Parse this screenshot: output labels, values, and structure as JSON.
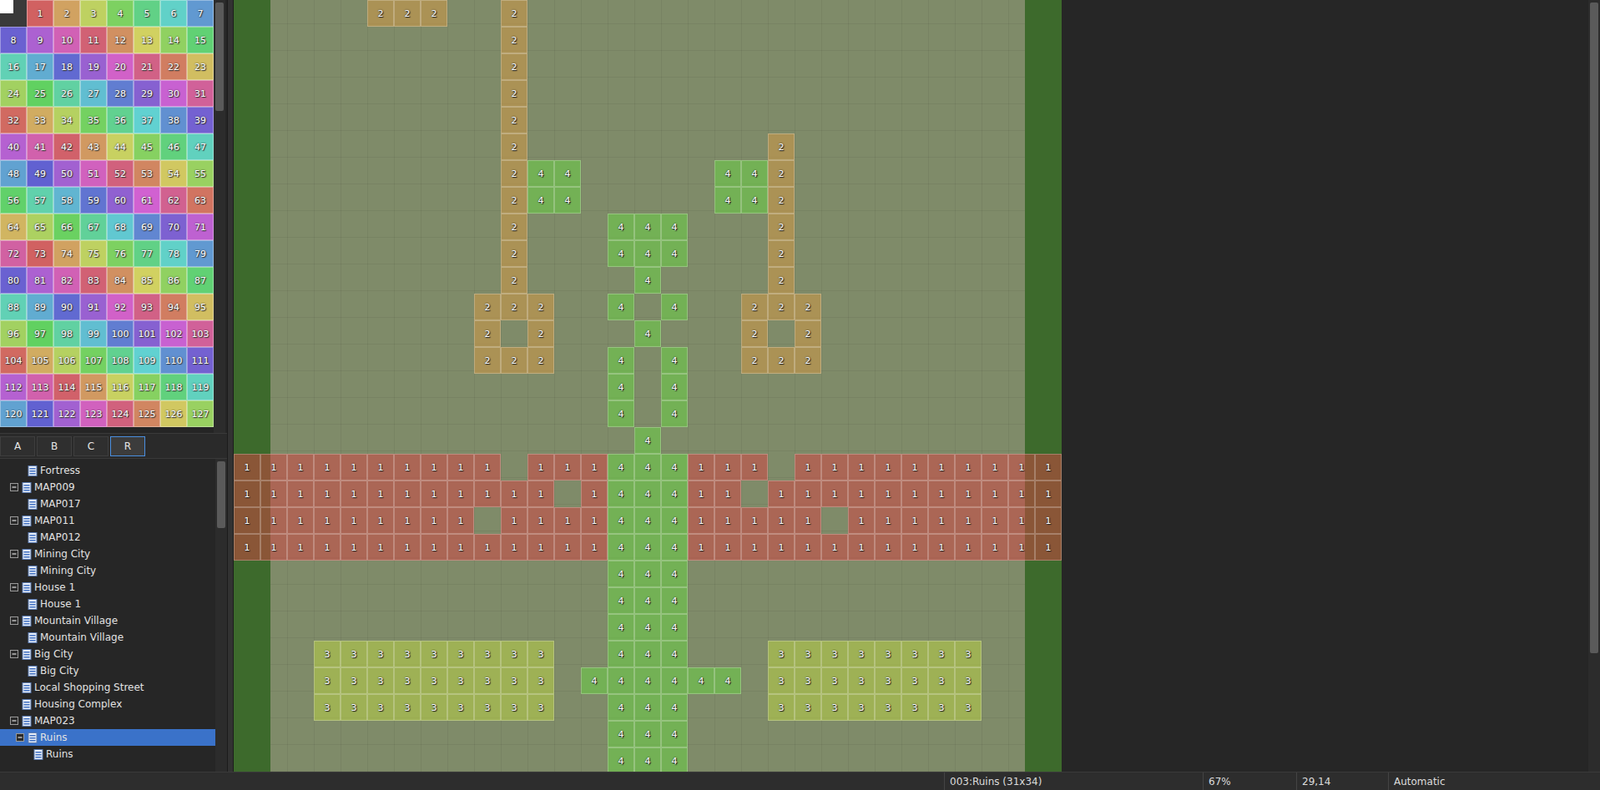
{
  "palette": {
    "eraser": true,
    "regions": [
      "1",
      "2",
      "3",
      "4",
      "5",
      "6",
      "7",
      "8",
      "9",
      "10",
      "11",
      "12",
      "13",
      "14",
      "15",
      "16",
      "17",
      "18",
      "19",
      "20",
      "21",
      "22",
      "23",
      "24",
      "25",
      "26",
      "27",
      "28",
      "29",
      "30",
      "31",
      "32",
      "33",
      "34",
      "35",
      "36",
      "37",
      "38",
      "39",
      "40",
      "41",
      "42",
      "43",
      "44",
      "45",
      "46",
      "47",
      "48",
      "49",
      "50",
      "51",
      "52",
      "53",
      "54",
      "55",
      "56",
      "57",
      "58",
      "59",
      "60",
      "61",
      "62",
      "63",
      "64",
      "65",
      "66",
      "67",
      "68",
      "69",
      "70",
      "71",
      "72",
      "73",
      "74",
      "75",
      "76",
      "77",
      "78",
      "79",
      "80",
      "81",
      "82",
      "83",
      "84",
      "85",
      "86",
      "87",
      "88",
      "89",
      "90",
      "91",
      "92",
      "93",
      "94",
      "95",
      "96",
      "97",
      "98",
      "99",
      "100",
      "101",
      "102",
      "103",
      "104",
      "105",
      "106",
      "107",
      "108",
      "109",
      "110",
      "111",
      "112",
      "113",
      "114",
      "115",
      "116",
      "117",
      "118",
      "119",
      "120",
      "121",
      "122",
      "123",
      "124",
      "125",
      "126",
      "127"
    ]
  },
  "tabs": [
    {
      "label": "A",
      "selected": false
    },
    {
      "label": "B",
      "selected": false
    },
    {
      "label": "C",
      "selected": false
    },
    {
      "label": "R",
      "selected": true
    }
  ],
  "tree": [
    {
      "label": "Fortress",
      "level": 2,
      "kind": "leaf",
      "expanded": false,
      "selected": false
    },
    {
      "label": "MAP009",
      "level": 1,
      "kind": "parent",
      "expanded": true,
      "selected": false
    },
    {
      "label": "MAP017",
      "level": 2,
      "kind": "leaf",
      "expanded": false,
      "selected": false
    },
    {
      "label": "MAP011",
      "level": 1,
      "kind": "parent",
      "expanded": true,
      "selected": false
    },
    {
      "label": "MAP012",
      "level": 2,
      "kind": "leaf",
      "expanded": false,
      "selected": false
    },
    {
      "label": "Mining City",
      "level": 1,
      "kind": "parent",
      "expanded": true,
      "selected": false
    },
    {
      "label": "Mining City",
      "level": 2,
      "kind": "leaf",
      "expanded": false,
      "selected": false
    },
    {
      "label": "House 1",
      "level": 1,
      "kind": "parent",
      "expanded": true,
      "selected": false
    },
    {
      "label": "House 1",
      "level": 2,
      "kind": "leaf",
      "expanded": false,
      "selected": false
    },
    {
      "label": "Mountain Village",
      "level": 1,
      "kind": "parent",
      "expanded": true,
      "selected": false
    },
    {
      "label": "Mountain Village",
      "level": 2,
      "kind": "leaf",
      "expanded": false,
      "selected": false
    },
    {
      "label": "Big City",
      "level": 1,
      "kind": "parent",
      "expanded": true,
      "selected": false
    },
    {
      "label": "Big City",
      "level": 2,
      "kind": "leaf",
      "expanded": false,
      "selected": false
    },
    {
      "label": "Local Shopping Street",
      "level": 1,
      "kind": "leaf",
      "expanded": false,
      "selected": false
    },
    {
      "label": "Housing Complex",
      "level": 1,
      "kind": "leaf",
      "expanded": false,
      "selected": false
    },
    {
      "label": "MAP023",
      "level": 1,
      "kind": "parent",
      "expanded": true,
      "selected": false
    },
    {
      "label": "Ruins",
      "level": 2,
      "kind": "parent",
      "expanded": true,
      "selected": true
    },
    {
      "label": "Ruins",
      "level": 3,
      "kind": "leaf",
      "expanded": false,
      "selected": false
    }
  ],
  "map": {
    "rows": [
      [
        "",
        "",
        "",
        "",
        "",
        "2",
        "2",
        "2",
        "",
        "",
        "2",
        "",
        "",
        "",
        "",
        "",
        "",
        "",
        "",
        "",
        "",
        "",
        "",
        "",
        "",
        "",
        "",
        "",
        "",
        "",
        ""
      ],
      [
        "",
        "",
        "",
        "",
        "",
        "",
        "",
        "",
        "",
        "",
        "2",
        "",
        "",
        "",
        "",
        "",
        "",
        "",
        "",
        "",
        "",
        "",
        "",
        "",
        "",
        "",
        "",
        "",
        "",
        "",
        ""
      ],
      [
        "",
        "",
        "",
        "",
        "",
        "",
        "",
        "",
        "",
        "",
        "2",
        "",
        "",
        "",
        "",
        "",
        "",
        "",
        "",
        "",
        "",
        "",
        "",
        "",
        "",
        "",
        "",
        "",
        "",
        "",
        ""
      ],
      [
        "",
        "",
        "",
        "",
        "",
        "",
        "",
        "",
        "",
        "",
        "2",
        "",
        "",
        "",
        "",
        "",
        "",
        "",
        "",
        "",
        "",
        "",
        "",
        "",
        "",
        "",
        "",
        "",
        "",
        "",
        ""
      ],
      [
        "",
        "",
        "",
        "",
        "",
        "",
        "",
        "",
        "",
        "",
        "2",
        "",
        "",
        "",
        "",
        "",
        "",
        "",
        "",
        "",
        "",
        "",
        "",
        "",
        "",
        "",
        "",
        "",
        "",
        "",
        ""
      ],
      [
        "",
        "",
        "",
        "",
        "",
        "",
        "",
        "",
        "",
        "",
        "2",
        "",
        "",
        "",
        "",
        "",
        "",
        "",
        "",
        "",
        "2",
        "",
        "",
        "",
        "",
        "",
        "",
        "",
        "",
        "",
        ""
      ],
      [
        "",
        "",
        "",
        "",
        "",
        "",
        "",
        "",
        "",
        "",
        "2",
        "4",
        "4",
        "",
        "",
        "",
        "",
        "",
        "4",
        "4",
        "2",
        "",
        "",
        "",
        "",
        "",
        "",
        "",
        "",
        "",
        ""
      ],
      [
        "",
        "",
        "",
        "",
        "",
        "",
        "",
        "",
        "",
        "",
        "2",
        "4",
        "4",
        "",
        "",
        "",
        "",
        "",
        "4",
        "4",
        "2",
        "",
        "",
        "",
        "",
        "",
        "",
        "",
        "",
        "",
        ""
      ],
      [
        "",
        "",
        "",
        "",
        "",
        "",
        "",
        "",
        "",
        "",
        "2",
        "",
        "",
        "",
        "4",
        "4",
        "4",
        "",
        "",
        "",
        "2",
        "",
        "",
        "",
        "",
        "",
        "",
        "",
        "",
        "",
        ""
      ],
      [
        "",
        "",
        "",
        "",
        "",
        "",
        "",
        "",
        "",
        "",
        "2",
        "",
        "",
        "",
        "4",
        "4",
        "4",
        "",
        "",
        "",
        "2",
        "",
        "",
        "",
        "",
        "",
        "",
        "",
        "",
        "",
        ""
      ],
      [
        "",
        "",
        "",
        "",
        "",
        "",
        "",
        "",
        "",
        "",
        "2",
        "",
        "",
        "",
        "",
        "4",
        "",
        "",
        "",
        "",
        "2",
        "",
        "",
        "",
        "",
        "",
        "",
        "",
        "",
        "",
        ""
      ],
      [
        "",
        "",
        "",
        "",
        "",
        "",
        "",
        "",
        "",
        "2",
        "2",
        "2",
        "",
        "",
        "4",
        "",
        "4",
        "",
        "",
        "2",
        "2",
        "2",
        "",
        "",
        "",
        "",
        "",
        "",
        "",
        "",
        ""
      ],
      [
        "",
        "",
        "",
        "",
        "",
        "",
        "",
        "",
        "",
        "2",
        "",
        "2",
        "",
        "",
        "",
        "4",
        "",
        "",
        "",
        "2",
        "",
        "2",
        "",
        "",
        "",
        "",
        "",
        "",
        "",
        "",
        ""
      ],
      [
        "",
        "",
        "",
        "",
        "",
        "",
        "",
        "",
        "",
        "2",
        "2",
        "2",
        "",
        "",
        "4",
        "",
        "4",
        "",
        "",
        "2",
        "2",
        "2",
        "",
        "",
        "",
        "",
        "",
        "",
        "",
        "",
        ""
      ],
      [
        "",
        "",
        "",
        "",
        "",
        "",
        "",
        "",
        "",
        "",
        "",
        "",
        "",
        "",
        "4",
        "",
        "4",
        "",
        "",
        "",
        "",
        "",
        "",
        "",
        "",
        "",
        "",
        "",
        "",
        "",
        ""
      ],
      [
        "",
        "",
        "",
        "",
        "",
        "",
        "",
        "",
        "",
        "",
        "",
        "",
        "",
        "",
        "4",
        "",
        "4",
        "",
        "",
        "",
        "",
        "",
        "",
        "",
        "",
        "",
        "",
        "",
        "",
        "",
        ""
      ],
      [
        "",
        "",
        "",
        "",
        "",
        "",
        "",
        "",
        "",
        "",
        "",
        "",
        "",
        "",
        "",
        "4",
        "",
        "",
        "",
        "",
        "",
        "",
        "",
        "",
        "",
        "",
        "",
        "",
        "",
        "",
        ""
      ],
      [
        "1",
        "1",
        "1",
        "1",
        "1",
        "1",
        "1",
        "1",
        "1",
        "1",
        "",
        "1",
        "1",
        "1",
        "4",
        "4",
        "4",
        "1",
        "1",
        "1",
        "",
        "1",
        "1",
        "1",
        "1",
        "1",
        "1",
        "1",
        "1",
        "1",
        "1"
      ],
      [
        "1",
        "1",
        "1",
        "1",
        "1",
        "1",
        "1",
        "1",
        "1",
        "1",
        "1",
        "1",
        "",
        "1",
        "4",
        "4",
        "4",
        "1",
        "1",
        "",
        "1",
        "1",
        "1",
        "1",
        "1",
        "1",
        "1",
        "1",
        "1",
        "1",
        "1"
      ],
      [
        "1",
        "1",
        "1",
        "1",
        "1",
        "1",
        "1",
        "1",
        "1",
        "",
        "1",
        "1",
        "1",
        "1",
        "4",
        "4",
        "4",
        "1",
        "1",
        "1",
        "1",
        "1",
        "",
        "1",
        "1",
        "1",
        "1",
        "1",
        "1",
        "1",
        "1"
      ],
      [
        "1",
        "1",
        "1",
        "1",
        "1",
        "1",
        "1",
        "1",
        "1",
        "1",
        "1",
        "1",
        "1",
        "1",
        "4",
        "4",
        "4",
        "1",
        "1",
        "1",
        "1",
        "1",
        "1",
        "1",
        "1",
        "1",
        "1",
        "1",
        "1",
        "1",
        "1"
      ],
      [
        "",
        "",
        "",
        "",
        "",
        "",
        "",
        "",
        "",
        "",
        "",
        "",
        "",
        "",
        "4",
        "4",
        "4",
        "",
        "",
        "",
        "",
        "",
        "",
        "",
        "",
        "",
        "",
        "",
        "",
        "",
        ""
      ],
      [
        "",
        "",
        "",
        "",
        "",
        "",
        "",
        "",
        "",
        "",
        "",
        "",
        "",
        "",
        "4",
        "4",
        "4",
        "",
        "",
        "",
        "",
        "",
        "",
        "",
        "",
        "",
        "",
        "",
        "",
        "",
        ""
      ],
      [
        "",
        "",
        "",
        "",
        "",
        "",
        "",
        "",
        "",
        "",
        "",
        "",
        "",
        "",
        "4",
        "4",
        "4",
        "",
        "",
        "",
        "",
        "",
        "",
        "",
        "",
        "",
        "",
        "",
        "",
        "",
        ""
      ],
      [
        "",
        "",
        "",
        "3",
        "3",
        "3",
        "3",
        "3",
        "3",
        "3",
        "3",
        "3",
        "",
        "",
        "4",
        "4",
        "4",
        "",
        "",
        "",
        "3",
        "3",
        "3",
        "3",
        "3",
        "3",
        "3",
        "3",
        "",
        "",
        ""
      ],
      [
        "",
        "",
        "",
        "3",
        "3",
        "3",
        "3",
        "3",
        "3",
        "3",
        "3",
        "3",
        "",
        "4",
        "4",
        "4",
        "4",
        "4",
        "4",
        "",
        "3",
        "3",
        "3",
        "3",
        "3",
        "3",
        "3",
        "3",
        "",
        "",
        ""
      ],
      [
        "",
        "",
        "",
        "3",
        "3",
        "3",
        "3",
        "3",
        "3",
        "3",
        "3",
        "3",
        "",
        "",
        "4",
        "4",
        "4",
        "",
        "",
        "",
        "3",
        "3",
        "3",
        "3",
        "3",
        "3",
        "3",
        "3",
        "",
        "",
        ""
      ],
      [
        "",
        "",
        "",
        "",
        "",
        "",
        "",
        "",
        "",
        "",
        "",
        "",
        "",
        "",
        "4",
        "4",
        "4",
        "",
        "",
        "",
        "",
        "",
        "",
        "",
        "",
        "",
        "",
        "",
        "",
        "",
        ""
      ],
      [
        "",
        "",
        "",
        "",
        "",
        "",
        "",
        "",
        "",
        "",
        "",
        "",
        "",
        "",
        "4",
        "4",
        "4",
        "",
        "",
        "",
        "",
        "",
        "",
        "",
        "",
        "",
        "",
        "",
        "",
        "",
        ""
      ]
    ]
  },
  "status_bar": {
    "map": "003:Ruins (31x34)",
    "zoom": "67%",
    "coords": "29,14",
    "mode": "Automatic"
  }
}
